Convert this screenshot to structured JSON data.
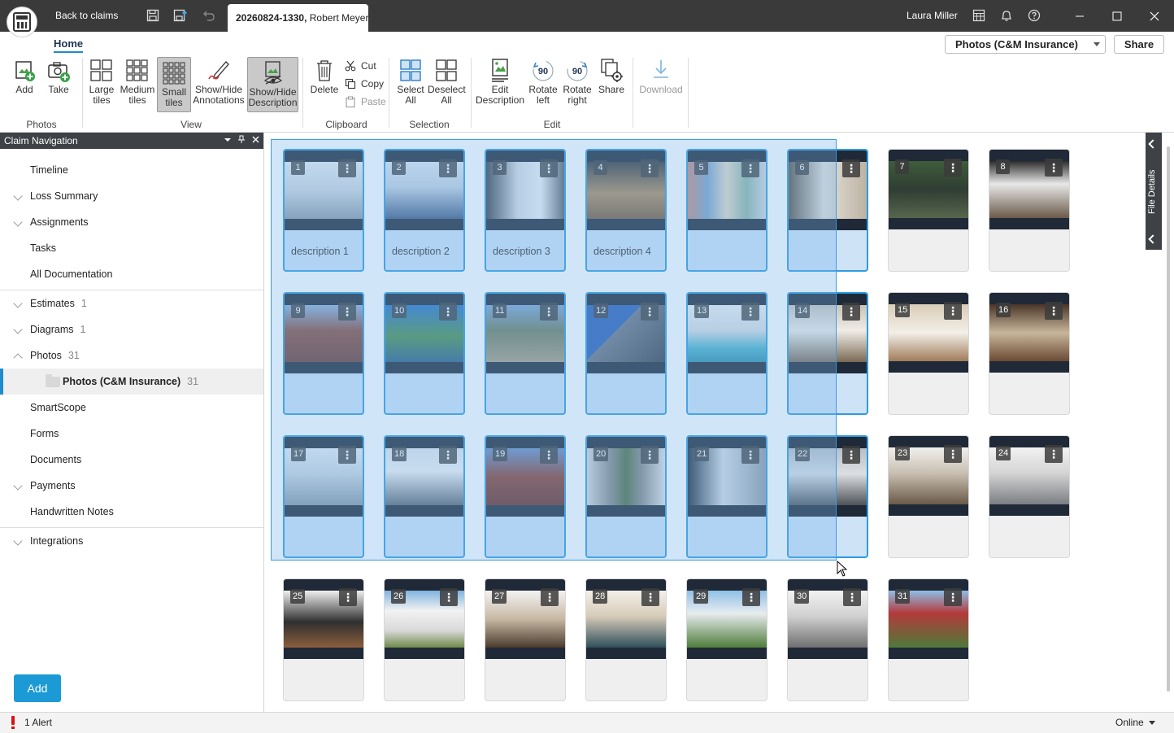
{
  "titlebar": {
    "back_label": "Back to claims",
    "doc_tab_id": "20260824-1330,",
    "doc_tab_name": " Robert Meyer",
    "user_name": "Laura Miller"
  },
  "ribbon": {
    "home_tab": "Home",
    "album_dropdown": "Photos (C&M Insurance)",
    "share_top": "Share",
    "groups": {
      "photos": "Photos",
      "view": "View",
      "clipboard": "Clipboard",
      "selection": "Selection",
      "edit": "Edit"
    },
    "buttons": {
      "add": "Add",
      "take": "Take",
      "large_tiles_1": "Large",
      "large_tiles_2": "tiles",
      "medium_tiles_1": "Medium",
      "medium_tiles_2": "tiles",
      "small_tiles_1": "Small",
      "small_tiles_2": "tiles",
      "annotations_1": "Show/Hide",
      "annotations_2": "Annotations",
      "description_1": "Show/Hide",
      "description_2": "Description",
      "delete": "Delete",
      "cut": "Cut",
      "copy": "Copy",
      "paste": "Paste",
      "select_all_1": "Select",
      "select_all_2": "All",
      "deselect_all_1": "Deselect",
      "deselect_all_2": "All",
      "edit_desc_1": "Edit",
      "edit_desc_2": "Description",
      "rotate_left_1": "Rotate",
      "rotate_left_2": "left",
      "rotate_right_1": "Rotate",
      "rotate_right_2": "right",
      "share": "Share",
      "download": "Download",
      "rotate_badge": "90"
    }
  },
  "sidebar": {
    "title": "Claim Navigation",
    "items": [
      {
        "label": "Timeline",
        "count": ""
      },
      {
        "label": "Loss Summary",
        "count": ""
      },
      {
        "label": "Assignments",
        "count": ""
      },
      {
        "label": "Tasks",
        "count": ""
      },
      {
        "label": "All Documentation",
        "count": ""
      },
      {
        "label": "Estimates",
        "count": "1"
      },
      {
        "label": "Diagrams",
        "count": "1"
      },
      {
        "label": "Photos",
        "count": "31"
      },
      {
        "label": "Photos (C&M Insurance)",
        "count": "31"
      },
      {
        "label": "SmartScope",
        "count": ""
      },
      {
        "label": "Forms",
        "count": ""
      },
      {
        "label": "Documents",
        "count": ""
      },
      {
        "label": "Payments",
        "count": ""
      },
      {
        "label": "Handwritten Notes",
        "count": ""
      },
      {
        "label": "Integrations",
        "count": ""
      }
    ],
    "add_button": "Add"
  },
  "right_rail": {
    "label": "File Details"
  },
  "tiles": [
    {
      "n": "1",
      "desc": "description 1",
      "selected": true
    },
    {
      "n": "2",
      "desc": "description 2",
      "selected": true
    },
    {
      "n": "3",
      "desc": "description 3",
      "selected": true
    },
    {
      "n": "4",
      "desc": "description 4",
      "selected": true
    },
    {
      "n": "5",
      "desc": "",
      "selected": true
    },
    {
      "n": "6",
      "desc": "",
      "selected": true
    },
    {
      "n": "7",
      "desc": "",
      "selected": false
    },
    {
      "n": "8",
      "desc": "",
      "selected": false
    },
    {
      "n": "9",
      "desc": "",
      "selected": true
    },
    {
      "n": "10",
      "desc": "",
      "selected": true
    },
    {
      "n": "11",
      "desc": "",
      "selected": true
    },
    {
      "n": "12",
      "desc": "",
      "selected": true
    },
    {
      "n": "13",
      "desc": "",
      "selected": true
    },
    {
      "n": "14",
      "desc": "",
      "selected": true
    },
    {
      "n": "15",
      "desc": "",
      "selected": false
    },
    {
      "n": "16",
      "desc": "",
      "selected": false
    },
    {
      "n": "17",
      "desc": "",
      "selected": true
    },
    {
      "n": "18",
      "desc": "",
      "selected": true
    },
    {
      "n": "19",
      "desc": "",
      "selected": true
    },
    {
      "n": "20",
      "desc": "",
      "selected": true
    },
    {
      "n": "21",
      "desc": "",
      "selected": true
    },
    {
      "n": "22",
      "desc": "",
      "selected": true
    },
    {
      "n": "23",
      "desc": "",
      "selected": false
    },
    {
      "n": "24",
      "desc": "",
      "selected": false
    },
    {
      "n": "25",
      "desc": "",
      "selected": false
    },
    {
      "n": "26",
      "desc": "",
      "selected": false
    },
    {
      "n": "27",
      "desc": "",
      "selected": false
    },
    {
      "n": "28",
      "desc": "",
      "selected": false
    },
    {
      "n": "29",
      "desc": "",
      "selected": false
    },
    {
      "n": "30",
      "desc": "",
      "selected": false
    },
    {
      "n": "31",
      "desc": "",
      "selected": false
    }
  ],
  "tile_menu_glyph": "⋮",
  "status": {
    "alert": "1 Alert",
    "online": "Online"
  },
  "colors": {
    "accent": "#1f8ccd",
    "selection": "#2e9be0",
    "titlebar": "#3a3a3a",
    "add_button": "#1c9ad6"
  }
}
